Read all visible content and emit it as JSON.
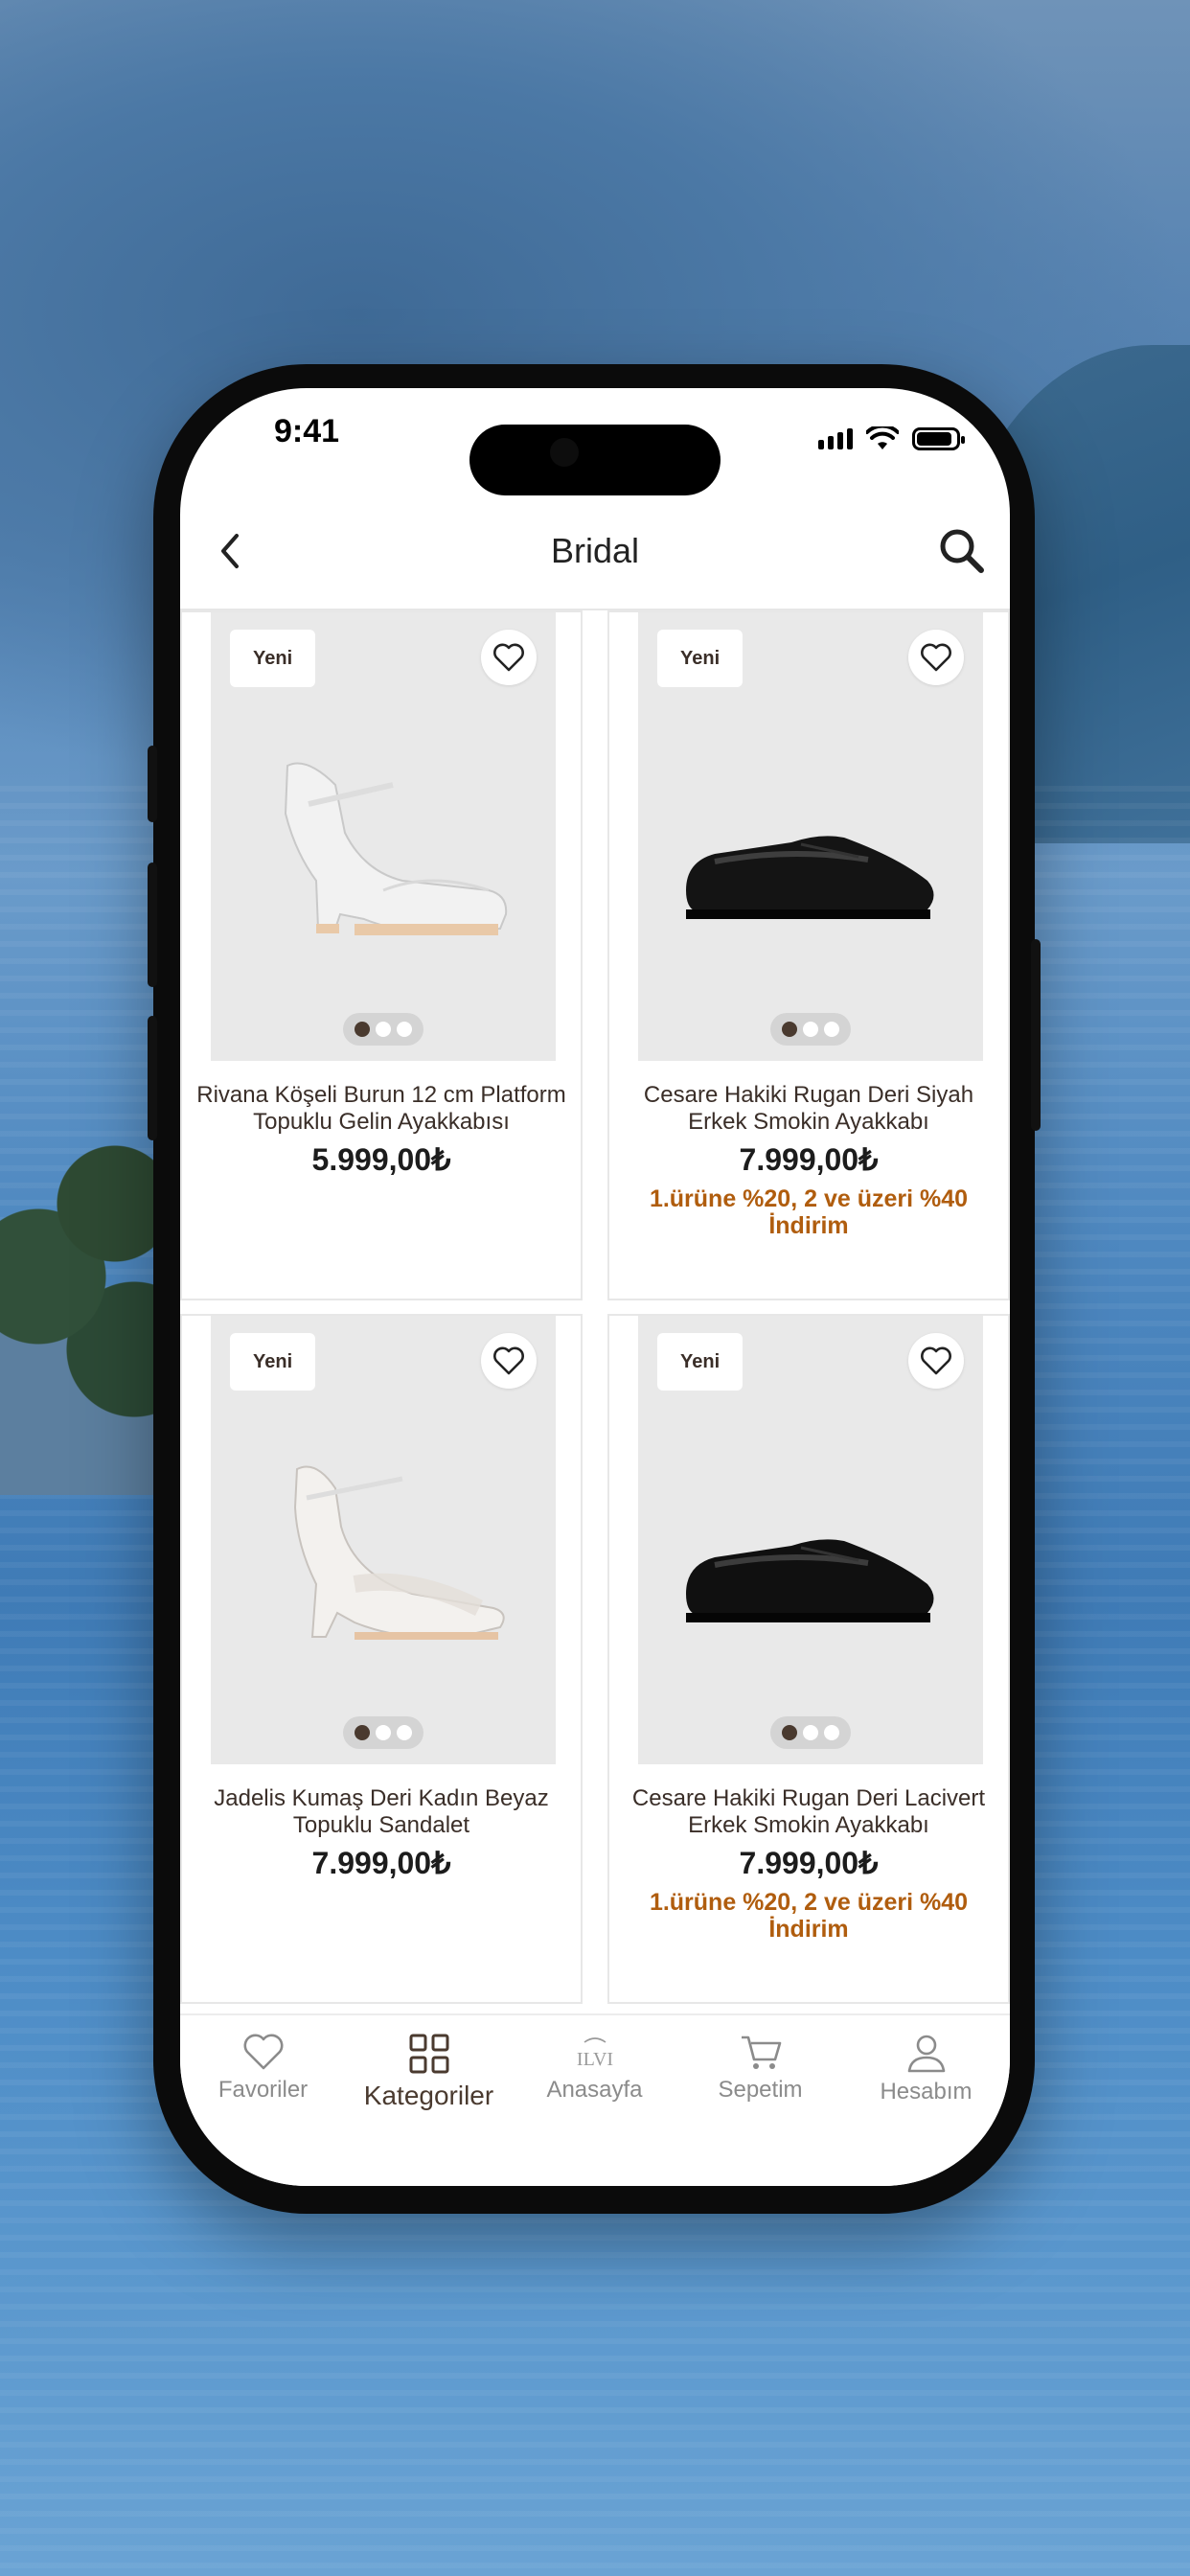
{
  "status": {
    "time": "9:41"
  },
  "header": {
    "title": "Bridal"
  },
  "products": [
    {
      "badge": "Yeni",
      "name": "Rivana Köşeli Burun 12 cm Platform Topuklu Gelin Ayakkabısı",
      "price": "5.999,00₺",
      "promo": "",
      "image_icon": "white-platform-sandal-image"
    },
    {
      "badge": "Yeni",
      "name": "Cesare Hakiki Rugan Deri Siyah Erkek Smokin Ayakkabı",
      "price": "7.999,00₺",
      "promo": "1.ürüne %20, 2 ve üzeri %40 İndirim",
      "image_icon": "black-patent-shoe-image"
    },
    {
      "badge": "Yeni",
      "name": "Jadelis Kumaş Deri Kadın Beyaz Topuklu Sandalet",
      "price": "7.999,00₺",
      "promo": "",
      "image_icon": "white-lace-heel-image"
    },
    {
      "badge": "Yeni",
      "name": "Cesare Hakiki Rugan Deri Lacivert Erkek Smokin Ayakkabı",
      "price": "7.999,00₺",
      "promo": "1.ürüne %20, 2 ve üzeri %40 İndirim",
      "image_icon": "black-patent-shoe-image"
    }
  ],
  "tabs": [
    {
      "label": "Favoriler",
      "icon": "heart-icon",
      "active": false
    },
    {
      "label": "Kategoriler",
      "icon": "grid-icon",
      "active": true
    },
    {
      "label": "Anasayfa",
      "icon": "ilvi-logo-icon",
      "active": false
    },
    {
      "label": "Sepetim",
      "icon": "cart-icon",
      "active": false
    },
    {
      "label": "Hesabım",
      "icon": "user-icon",
      "active": false
    }
  ],
  "colors": {
    "accent": "#4a3a2f",
    "promo": "#b05d0e",
    "image_bg": "#e9e9e9"
  }
}
